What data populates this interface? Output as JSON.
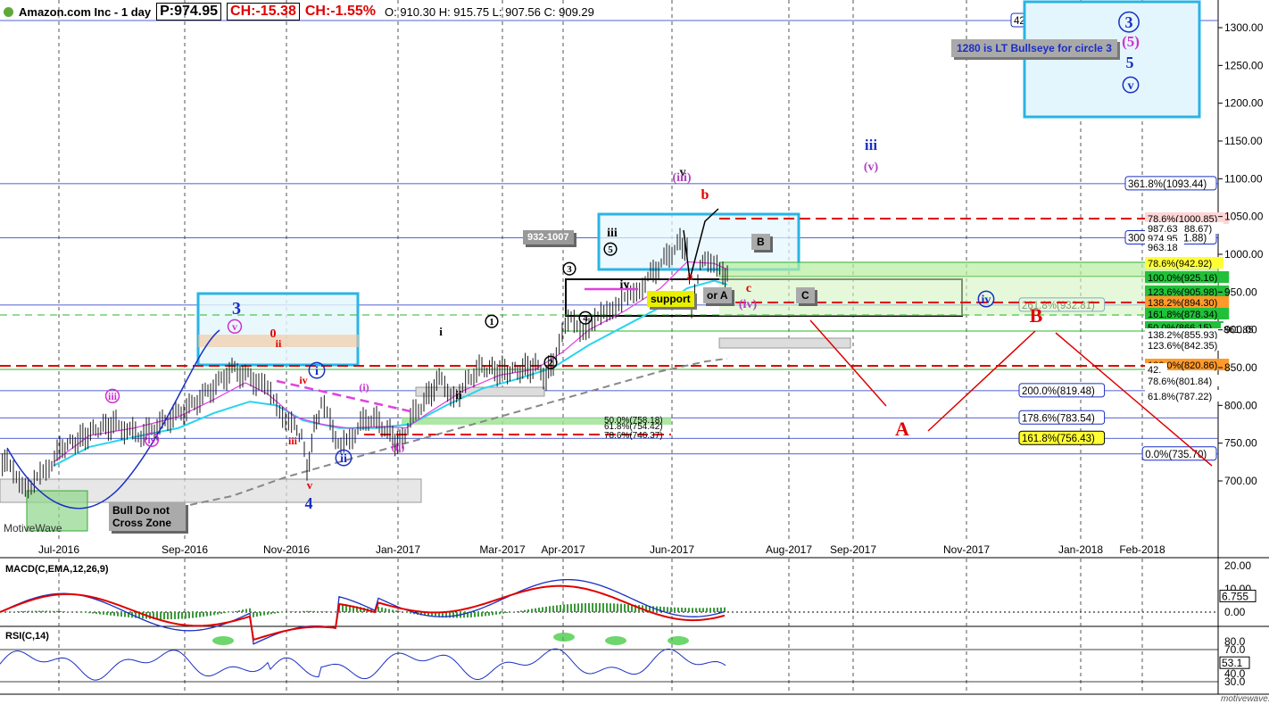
{
  "header": {
    "title": "Amazon.com Inc - 1 day",
    "price": "P:974.95",
    "change": "CH:-15.38",
    "change_pct": "CH:-1.55%",
    "ohlc": "O: 910.30  H: 915.75  L: 907.56  C: 909.29"
  },
  "watermark": "MotiveWave",
  "footer_brand": "motivewave.com",
  "colors": {
    "price": "#1a1a1a",
    "ma_fast": "#e040e0",
    "ma_mid": "#2ad4ee",
    "ma_slow": "#888888",
    "down": "#e00000",
    "wave_blue": "#1a2fc4",
    "box": "#2ab4e6"
  },
  "chart_data": [
    {
      "type": "line",
      "title": "",
      "series_name": "",
      "xlabel": "",
      "ylabel": "",
      "ylim": [
        640,
        1350
      ],
      "x": [
        "Jul-2016",
        "Sep-2016",
        "Nov-2016",
        "Jan-2017",
        "Mar-2017",
        "Apr-2017",
        "Jun-2017",
        "Aug-2017",
        "Sep-2017",
        "Nov-2017",
        "Jan-2018",
        "Feb-2018"
      ],
      "y_ticks": [
        "1300.00",
        "1250.00",
        "1200.00",
        "1150.00",
        "1100.00",
        "1050.00",
        "1000.00",
        "950.00",
        "900.00",
        "850.00",
        "800.00",
        "750.00",
        "700.00"
      ],
      "price_points": [
        [
          0,
          730
        ],
        [
          8,
          722
        ],
        [
          15,
          710
        ],
        [
          25,
          700
        ],
        [
          35,
          690
        ],
        [
          45,
          705
        ],
        [
          55,
          720
        ],
        [
          70,
          745
        ],
        [
          90,
          755
        ],
        [
          110,
          770
        ],
        [
          130,
          775
        ],
        [
          155,
          760
        ],
        [
          170,
          768
        ],
        [
          185,
          778
        ],
        [
          200,
          790
        ],
        [
          215,
          800
        ],
        [
          230,
          815
        ],
        [
          245,
          830
        ],
        [
          260,
          848
        ],
        [
          275,
          840
        ],
        [
          290,
          830
        ],
        [
          300,
          818
        ],
        [
          310,
          805
        ],
        [
          320,
          782
        ],
        [
          330,
          770
        ],
        [
          338,
          760
        ],
        [
          344,
          712
        ],
        [
          352,
          770
        ],
        [
          360,
          800
        ],
        [
          370,
          778
        ],
        [
          382,
          742
        ],
        [
          395,
          760
        ],
        [
          410,
          783
        ],
        [
          425,
          778
        ],
        [
          440,
          757
        ],
        [
          448,
          747
        ],
        [
          460,
          782
        ],
        [
          475,
          805
        ],
        [
          495,
          838
        ],
        [
          505,
          815
        ],
        [
          515,
          808
        ],
        [
          525,
          836
        ],
        [
          540,
          850
        ],
        [
          560,
          845
        ],
        [
          580,
          846
        ],
        [
          600,
          852
        ],
        [
          612,
          838
        ],
        [
          620,
          860
        ],
        [
          630,
          895
        ],
        [
          640,
          912
        ],
        [
          650,
          903
        ],
        [
          660,
          905
        ],
        [
          670,
          912
        ],
        [
          680,
          925
        ],
        [
          690,
          935
        ],
        [
          700,
          940
        ],
        [
          710,
          945
        ],
        [
          720,
          960
        ],
        [
          735,
          980
        ],
        [
          750,
          1000
        ],
        [
          762,
          1015
        ],
        [
          770,
          1005
        ],
        [
          775,
          930
        ],
        [
          782,
          970
        ],
        [
          790,
          1000
        ],
        [
          800,
          985
        ],
        [
          810,
          970
        ],
        [
          815,
          975
        ]
      ],
      "ma_fast_points": [
        [
          60,
          725
        ],
        [
          100,
          760
        ],
        [
          150,
          770
        ],
        [
          200,
          785
        ],
        [
          240,
          808
        ],
        [
          275,
          830
        ],
        [
          300,
          815
        ],
        [
          330,
          785
        ],
        [
          360,
          775
        ],
        [
          390,
          770
        ],
        [
          430,
          772
        ],
        [
          455,
          770
        ],
        [
          480,
          790
        ],
        [
          520,
          820
        ],
        [
          560,
          840
        ],
        [
          600,
          848
        ],
        [
          630,
          870
        ],
        [
          660,
          900
        ],
        [
          700,
          925
        ],
        [
          740,
          955
        ],
        [
          770,
          990
        ],
        [
          800,
          988
        ],
        [
          815,
          980
        ]
      ],
      "ma_mid_points": [
        [
          60,
          720
        ],
        [
          100,
          745
        ],
        [
          150,
          758
        ],
        [
          200,
          770
        ],
        [
          240,
          790
        ],
        [
          280,
          805
        ],
        [
          310,
          800
        ],
        [
          340,
          780
        ],
        [
          380,
          770
        ],
        [
          420,
          770
        ],
        [
          460,
          775
        ],
        [
          500,
          800
        ],
        [
          540,
          822
        ],
        [
          580,
          835
        ],
        [
          620,
          850
        ],
        [
          660,
          880
        ],
        [
          700,
          905
        ],
        [
          740,
          930
        ],
        [
          770,
          955
        ],
        [
          800,
          965
        ],
        [
          815,
          960
        ]
      ],
      "ma_slow_points": [
        [
          150,
          650
        ],
        [
          200,
          665
        ],
        [
          260,
          680
        ],
        [
          320,
          705
        ],
        [
          380,
          725
        ],
        [
          440,
          745
        ],
        [
          500,
          765
        ],
        [
          560,
          785
        ],
        [
          620,
          805
        ],
        [
          680,
          825
        ],
        [
          740,
          845
        ],
        [
          790,
          858
        ],
        [
          815,
          862
        ]
      ],
      "fib_levels": [
        "423.6%(1309.41)",
        "361.8%(1093.44)",
        "300.0%(1021.88)",
        "261.8%(932.81)",
        "200.0%(819.48)",
        "178.6%(783.54)",
        "161.8%(756.43)",
        "0.0%(735.70)"
      ],
      "right_labels": [
        "78.6%(1000.85)",
        "61.8%(988.67)",
        "987.63",
        "974.95",
        "963.18",
        "78.6%(942.92)",
        "100.0%(925.16)",
        "123.6%(905.98)",
        "138.2%(894.30)",
        "161.8%(878.34)",
        "50.0%(866.15)",
        "138.2%(855.93)",
        "861.85",
        "123.6%(842.35)",
        "100.0%(820.86)",
        "42.",
        "78.6%(801.84)",
        "61.8%(787.22)"
      ],
      "small_fibs": [
        "50.0%(758.18)",
        "61.8%(754.42)",
        "78.6%(746.37)"
      ],
      "wave_labels": {
        "circle_big": [
          "3",
          "5",
          "v",
          "iii",
          "iv",
          "i",
          "ii",
          "1",
          "2",
          "3",
          "4",
          "5"
        ],
        "roman": [
          "i",
          "ii",
          "iii",
          "iv",
          "v",
          "iii",
          "iv",
          "v",
          "b",
          "c",
          "a"
        ],
        "major": [
          "3",
          "4",
          "A",
          "B",
          "(5)",
          "(iii)",
          "(v)",
          "(iv)",
          "(i)",
          "(ii)",
          "iii",
          "iv",
          "v",
          "0",
          "ii",
          "iii",
          "v"
        ]
      },
      "annotations": [
        "1280 is LT Bullseye for circle 3",
        "932-1007",
        "support",
        "or A",
        "B",
        "C",
        "Bull Do not Cross Zone"
      ]
    },
    {
      "type": "line",
      "title": "MACD(C,EMA,12,26,9)",
      "y_ticks": [
        "20.00",
        "10.00",
        "0.00"
      ],
      "value_label": "6.755"
    },
    {
      "type": "line",
      "title": "RSI(C,14)",
      "y_ticks": [
        "80.0",
        "70.0",
        "40.0",
        "30.0"
      ],
      "value_label": "53.1"
    }
  ]
}
